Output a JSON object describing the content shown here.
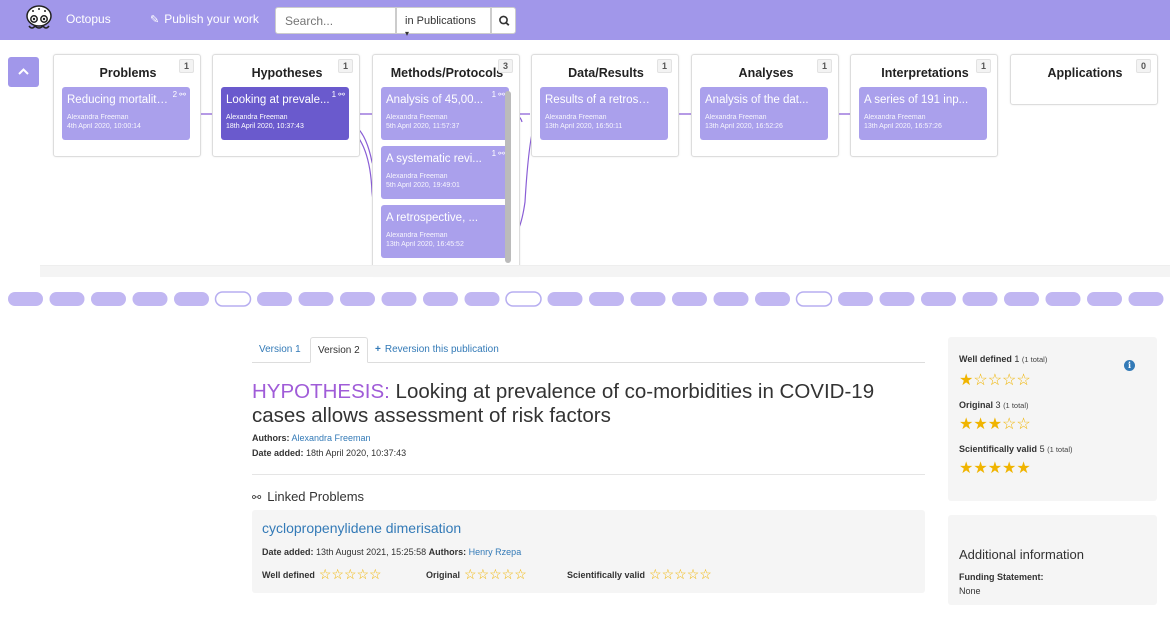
{
  "nav": {
    "brand": "Octopus",
    "publish": "Publish your work",
    "search_placeholder": "Search...",
    "scope": "in Publications"
  },
  "columns": [
    {
      "title": "Problems",
      "count": "1",
      "cards": [
        {
          "title": "Reducing mortality ...",
          "links": "2",
          "author": "Alexandra Freeman",
          "date": "4th April 2020, 10:00:14",
          "selected": false
        }
      ]
    },
    {
      "title": "Hypotheses",
      "count": "1",
      "cards": [
        {
          "title": "Looking at prevale...",
          "links": "1",
          "author": "Alexandra Freeman",
          "date": "18th April 2020, 10:37:43",
          "selected": true
        }
      ]
    },
    {
      "title": "Methods/Protocols",
      "count": "3",
      "cards": [
        {
          "title": "Analysis of 45,00...",
          "links": "1",
          "author": "Alexandra Freeman",
          "date": "5th April 2020, 11:57:37",
          "selected": false
        },
        {
          "title": "A systematic revi...",
          "links": "1",
          "author": "Alexandra Freeman",
          "date": "5th April 2020, 19:49:01",
          "selected": false
        },
        {
          "title": "A retrospective, ...",
          "links": "",
          "author": "Alexandra Freeman",
          "date": "13th April 2020, 16:45:52",
          "selected": false
        }
      ]
    },
    {
      "title": "Data/Results",
      "count": "1",
      "cards": [
        {
          "title": "Results of a retrosp...",
          "links": "",
          "author": "Alexandra Freeman",
          "date": "13th April 2020, 16:50:11",
          "selected": false
        }
      ]
    },
    {
      "title": "Analyses",
      "count": "1",
      "cards": [
        {
          "title": "Analysis of the dat...",
          "links": "",
          "author": "Alexandra Freeman",
          "date": "13th April 2020, 16:52:26",
          "selected": false
        }
      ]
    },
    {
      "title": "Interpretations",
      "count": "1",
      "cards": [
        {
          "title": "A series of 191 inp...",
          "links": "",
          "author": "Alexandra Freeman",
          "date": "13th April 2020, 16:57:26",
          "selected": false
        }
      ]
    },
    {
      "title": "Applications",
      "count": "0",
      "cards": []
    }
  ],
  "tabs": {
    "v1": "Version 1",
    "v2": "Version 2",
    "reversion": "Reversion this publication"
  },
  "publication": {
    "kind": "HYPOTHESIS:",
    "title": "Looking at prevalence of co-morbidities in COVID-19 cases allows assessment of risk factors",
    "authors_label": "Authors:",
    "author": "Alexandra Freeman",
    "date_label": "Date added:",
    "date": "18th April 2020, 10:37:43"
  },
  "linked": {
    "heading": "Linked Problems",
    "item": {
      "title": "cyclopropenylidene dimerisation",
      "date_label": "Date added:",
      "date": "13th August 2021, 15:25:58",
      "authors_label": "Authors:",
      "author": "Henry Rzepa",
      "ratings": [
        {
          "label": "Well defined",
          "stars": "☆☆☆☆☆"
        },
        {
          "label": "Original",
          "stars": "☆☆☆☆☆"
        },
        {
          "label": "Scientifically valid",
          "stars": "☆☆☆☆☆"
        }
      ]
    }
  },
  "ratings": [
    {
      "label": "Well defined",
      "value": "1",
      "total": "(1 total)",
      "stars": "★☆☆☆☆",
      "level": 1
    },
    {
      "label": "Original",
      "value": "3",
      "total": "(1 total)",
      "stars": "★★★☆☆",
      "level": 3
    },
    {
      "label": "Scientifically valid",
      "value": "5",
      "total": "(1 total)",
      "stars": "★★★★★",
      "level": 5
    }
  ],
  "additional": {
    "heading": "Additional information",
    "funding_label": "Funding Statement:",
    "funding_value": "None"
  },
  "colors": {
    "accent": "#a197ea",
    "selected": "#6a5acd",
    "kind": "#a05cd8",
    "link": "#337ab7",
    "star": "#f0b400"
  }
}
